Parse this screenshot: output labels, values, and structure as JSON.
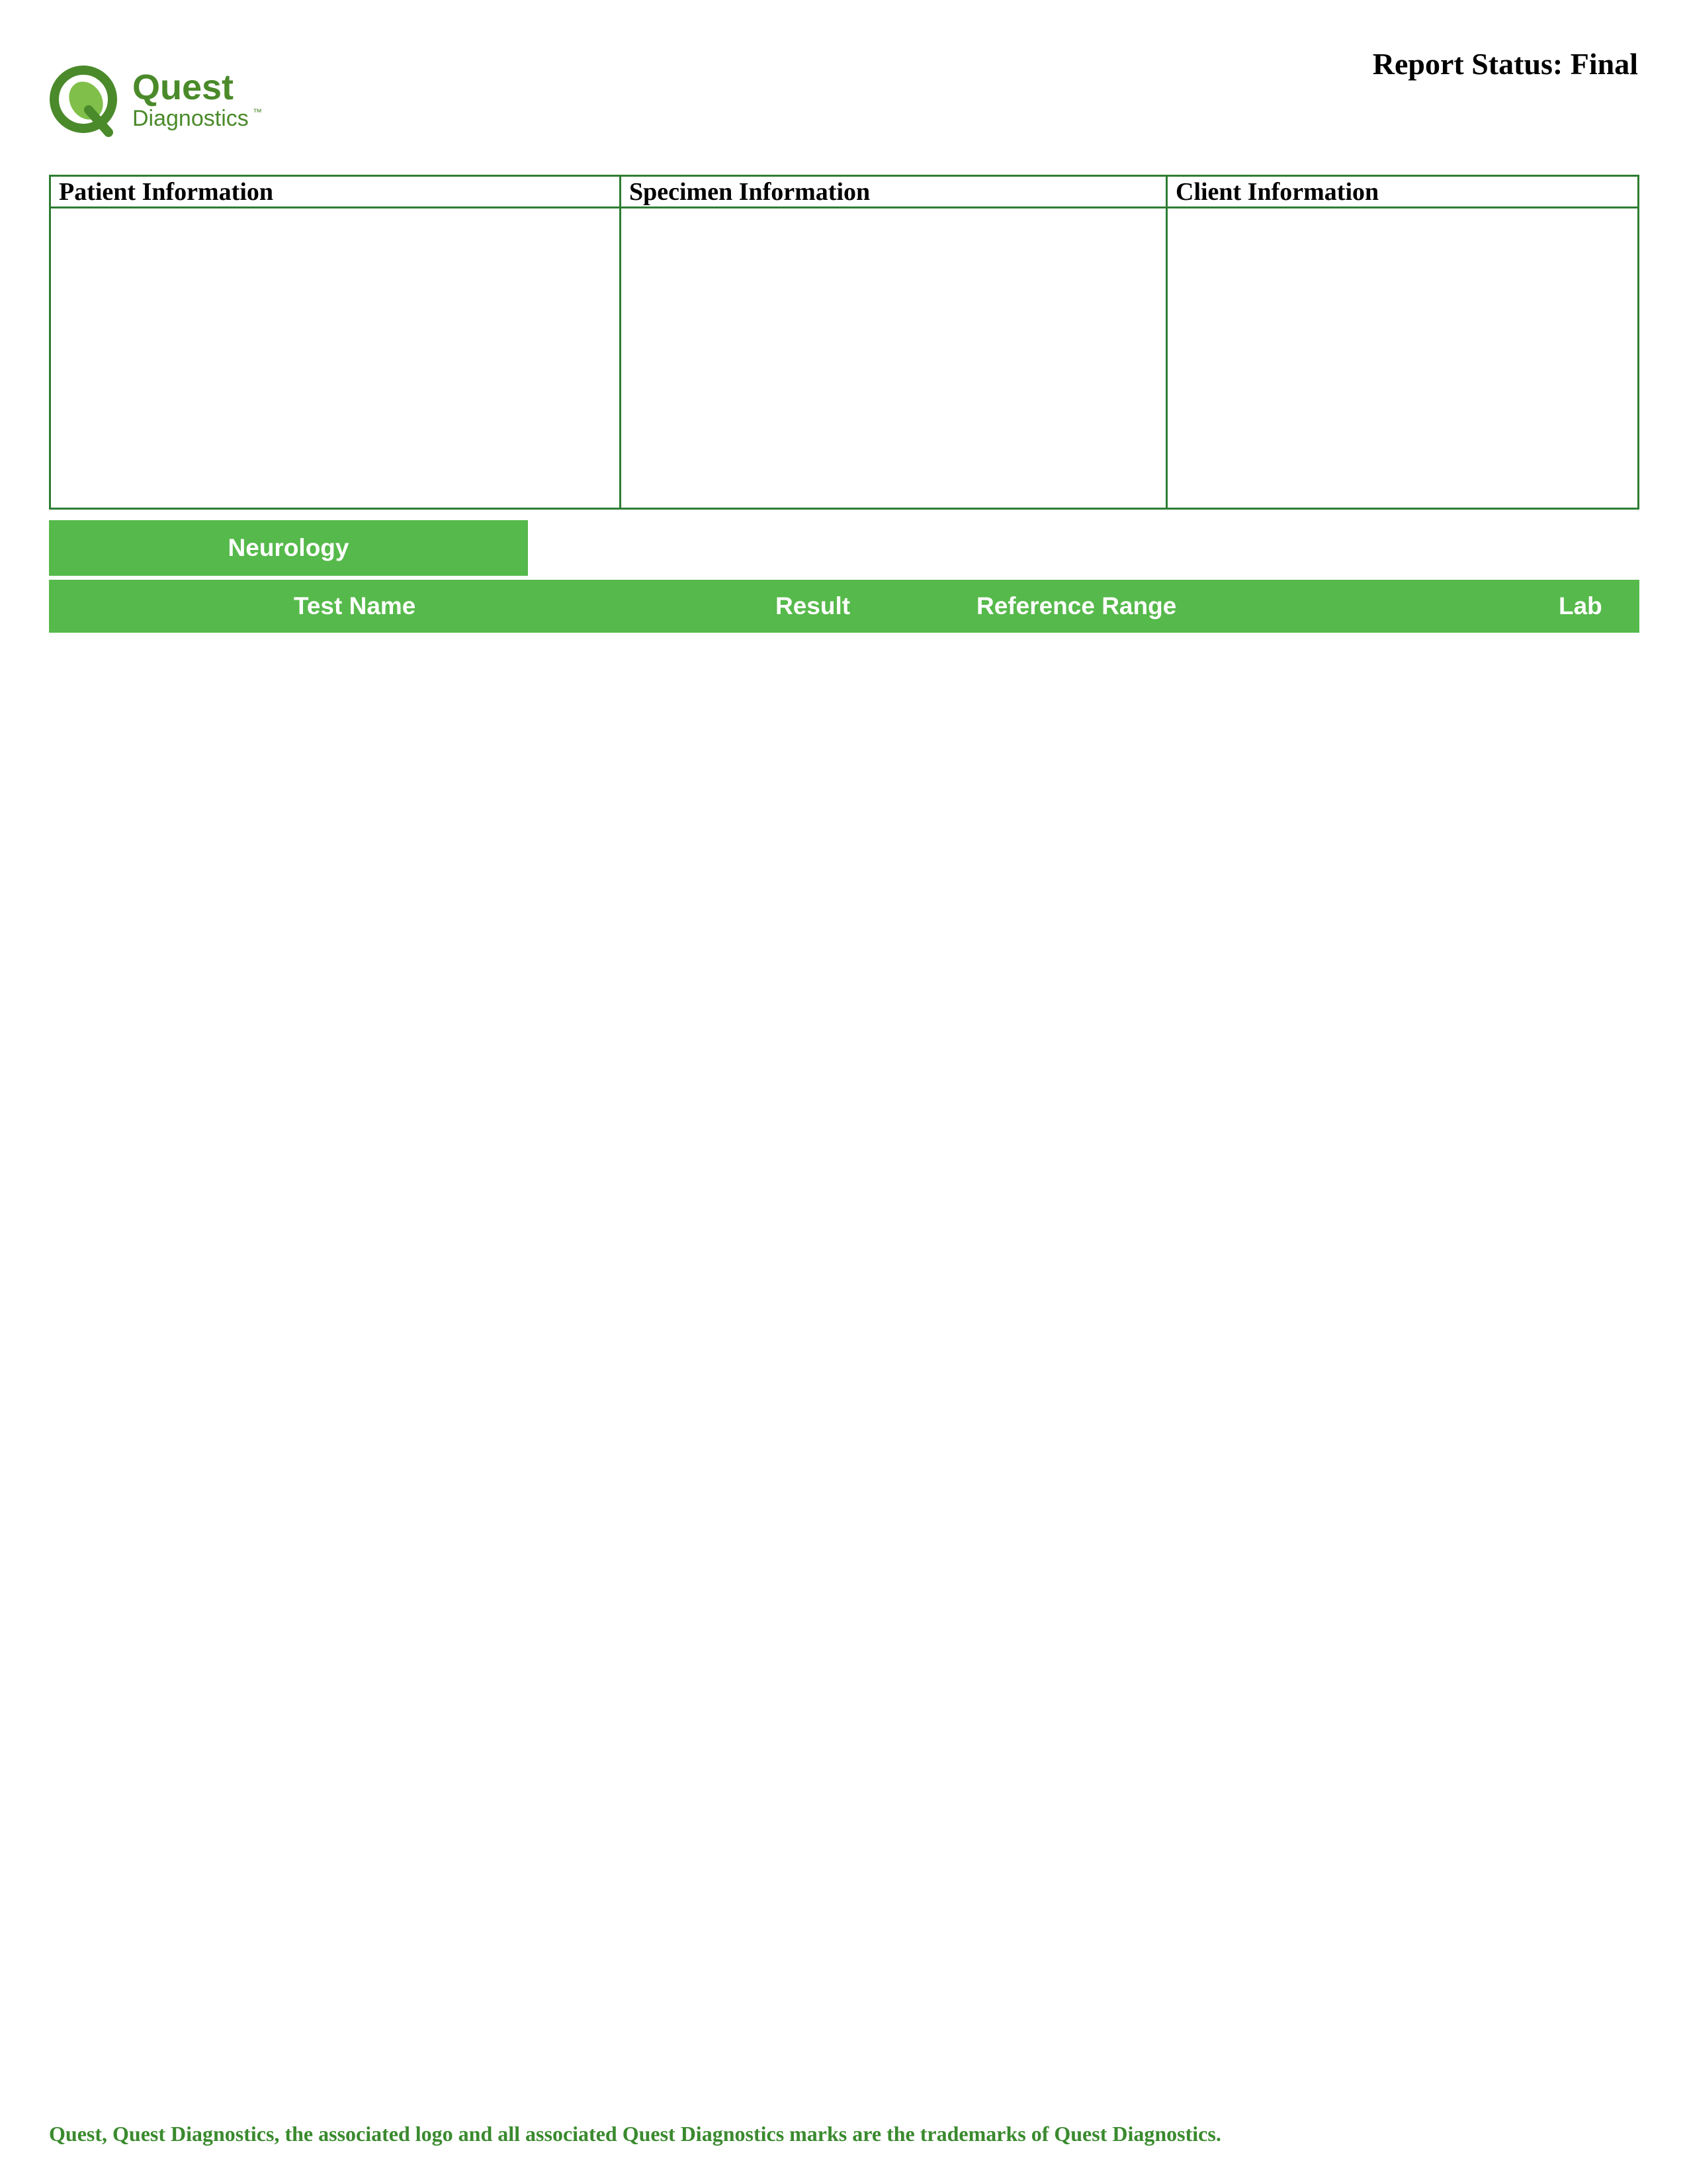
{
  "logo": {
    "line1": "Quest",
    "line2": "Diagnostics",
    "tm": "™",
    "brand_color": "#4a8a2a"
  },
  "report_status": "Report Status: Final",
  "info_table": {
    "patient_header": "Patient Information",
    "specimen_header": "Specimen Information",
    "client_header": "Client Information",
    "border_color": "#2e7d32"
  },
  "section": {
    "title": "Neurology",
    "color": "#56b94b"
  },
  "results_header": {
    "test_name": "Test Name",
    "result": "Result",
    "reference_range": "Reference Range",
    "lab": "Lab"
  },
  "footer": {
    "trademark": "Quest, Quest Diagnostics, the associated logo and all associated Quest Diagnostics marks are the trademarks of Quest Diagnostics."
  }
}
